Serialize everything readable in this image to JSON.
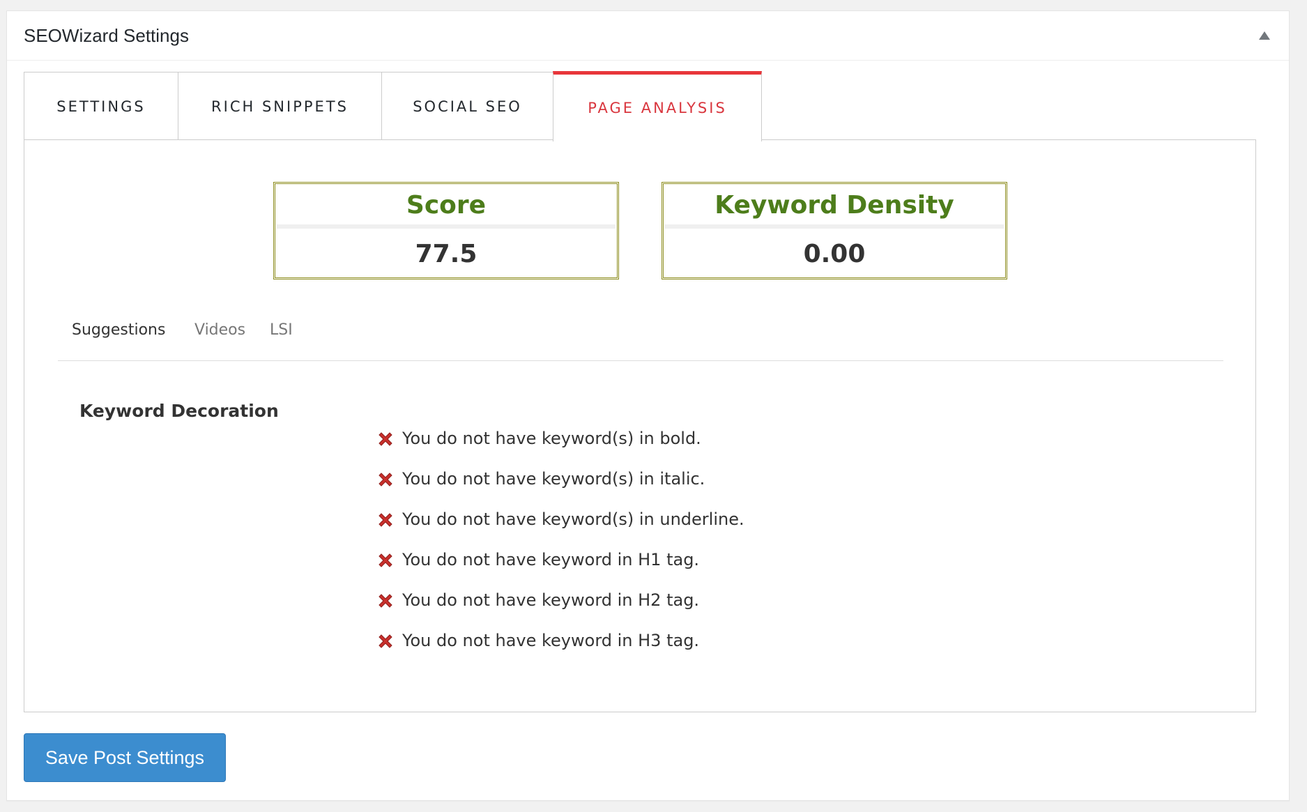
{
  "panel": {
    "title": "SEOWizard Settings",
    "toggle_icon": "triangle-up-icon"
  },
  "tabs": [
    {
      "label": "SETTINGS",
      "active": false
    },
    {
      "label": "RICH SNIPPETS",
      "active": false
    },
    {
      "label": "SOCIAL SEO",
      "active": false
    },
    {
      "label": "PAGE ANALYSIS",
      "active": true
    }
  ],
  "metrics": {
    "score": {
      "title": "Score",
      "value": "77.5"
    },
    "keyword_density": {
      "title": "Keyword Density",
      "value": "0.00"
    }
  },
  "subtabs": [
    {
      "label": "Suggestions",
      "active": true
    },
    {
      "label": "Videos",
      "active": false
    },
    {
      "label": "LSI",
      "active": false
    }
  ],
  "keyword_decoration": {
    "heading": "Keyword Decoration",
    "issues": [
      {
        "icon": "red-x-icon",
        "text": "You do not have keyword(s) in bold."
      },
      {
        "icon": "red-x-icon",
        "text": "You do not have keyword(s) in italic."
      },
      {
        "icon": "red-x-icon",
        "text": "You do not have keyword(s) in underline."
      },
      {
        "icon": "red-x-icon",
        "text": "You do not have keyword in H1 tag."
      },
      {
        "icon": "red-x-icon",
        "text": "You do not have keyword in H2 tag."
      },
      {
        "icon": "red-x-icon",
        "text": "You do not have keyword in H3 tag."
      }
    ]
  },
  "save_button": {
    "label": "Save Post Settings"
  },
  "colors": {
    "active_tab": "#d9363e",
    "metric_title": "#4d7d1b",
    "metric_border": "#8c8c1c",
    "error_icon": "#c9302c",
    "primary_button": "#3c8dcf"
  }
}
